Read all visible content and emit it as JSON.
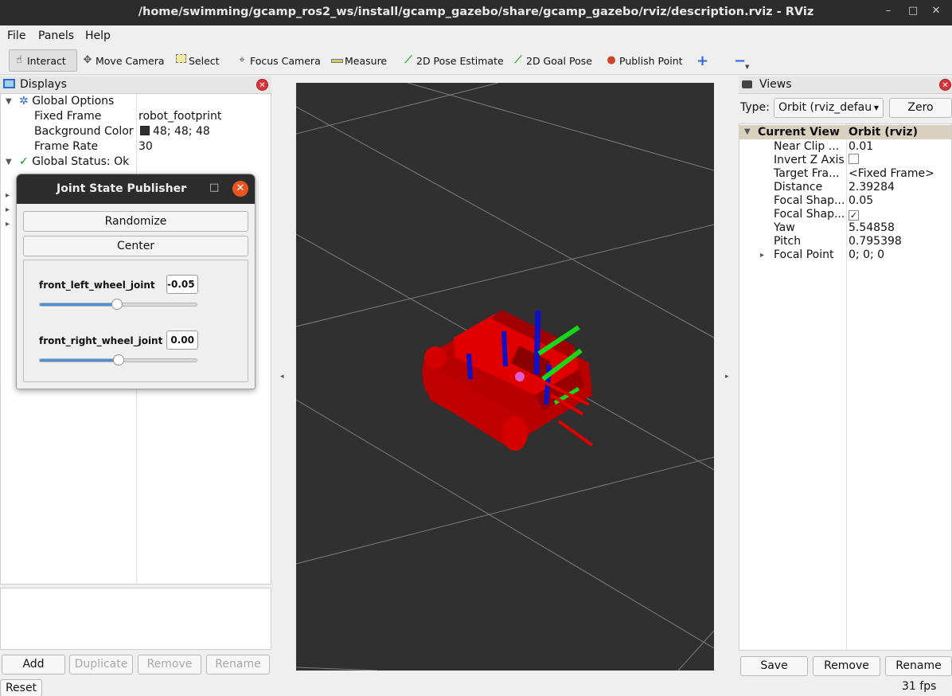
{
  "window": {
    "title": "/home/swimming/gcamp_ros2_ws/install/gcamp_gazebo/share/gcamp_gazebo/rviz/description.rviz - RViz",
    "minimize": "–",
    "maximize": "□",
    "close": "✕"
  },
  "menu": {
    "file": "File",
    "panels": "Panels",
    "help": "Help"
  },
  "toolbar": {
    "interact": "Interact",
    "move_camera": "Move Camera",
    "select": "Select",
    "focus_camera": "Focus Camera",
    "measure": "Measure",
    "pose_estimate": "2D Pose Estimate",
    "goal_pose": "2D Goal Pose",
    "publish_point": "Publish Point",
    "add_tool": "+",
    "remove_tool": "−"
  },
  "displays": {
    "title": "Displays",
    "global_options": "Global Options",
    "fixed_frame_label": "Fixed Frame",
    "fixed_frame_value": "robot_footprint",
    "bg_color_label": "Background Color",
    "bg_color_value": "48; 48; 48",
    "bg_color_hex": "#303030",
    "frame_rate_label": "Frame Rate",
    "frame_rate_value": "30",
    "global_status": "Global Status: Ok",
    "buttons": {
      "add": "Add",
      "duplicate": "Duplicate",
      "remove": "Remove",
      "rename": "Rename"
    }
  },
  "reset": "Reset",
  "views": {
    "title": "Views",
    "type_label": "Type:",
    "type_value": "Orbit (rviz_defau",
    "zero": "Zero",
    "header_col1": "Current View",
    "header_col2": "Orbit (rviz)",
    "rows": [
      {
        "name": "Near Clip ...",
        "value": "0.01"
      },
      {
        "name": "Invert Z Axis",
        "value": ""
      },
      {
        "name": "Target Fra...",
        "value": "<Fixed Frame>"
      },
      {
        "name": "Distance",
        "value": "2.39284"
      },
      {
        "name": "Focal Shap...",
        "value": "0.05"
      },
      {
        "name": "Focal Shap...",
        "value": ""
      },
      {
        "name": "Yaw",
        "value": "5.54858"
      },
      {
        "name": "Pitch",
        "value": "0.795398"
      },
      {
        "name": "Focal Point",
        "value": "0; 0; 0"
      }
    ],
    "buttons": {
      "save": "Save",
      "remove": "Remove",
      "rename": "Rename"
    }
  },
  "fps": "31 fps",
  "jsp": {
    "title": "Joint State Publisher",
    "randomize": "Randomize",
    "center": "Center",
    "joints": [
      {
        "name": "front_left_wheel_joint",
        "value": "-0.05",
        "fraction": 0.49
      },
      {
        "name": "front_right_wheel_joint",
        "value": "0.00",
        "fraction": 0.5
      }
    ]
  },
  "colors": {
    "robot_body": "#d40000",
    "axis_x": "#e00000",
    "axis_y": "#19d619",
    "axis_z": "#1010c8",
    "grid": "#8a8a8a"
  }
}
